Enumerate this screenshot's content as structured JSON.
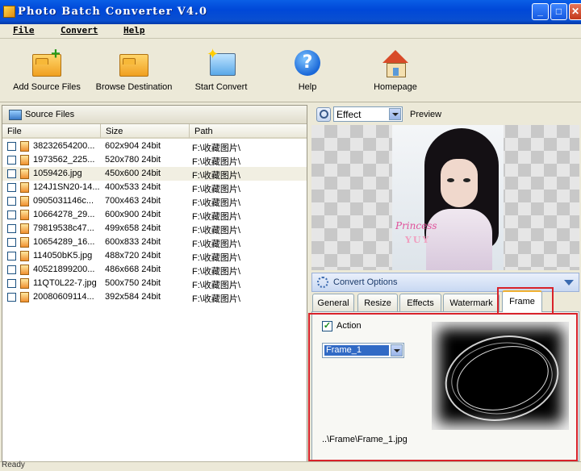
{
  "window": {
    "title": "Photo Batch Converter V4.0"
  },
  "menu": {
    "items": [
      "File",
      "Convert",
      "Help"
    ]
  },
  "toolbar": {
    "buttons": [
      {
        "label": "Add Source Files",
        "icon": "add-folder-icon"
      },
      {
        "label": "Browse Destination",
        "icon": "folder-icon"
      },
      {
        "label": "Start Convert",
        "icon": "magic-wand-icon"
      },
      {
        "label": "Help",
        "icon": "help-icon"
      },
      {
        "label": "Homepage",
        "icon": "home-icon"
      }
    ]
  },
  "source_files": {
    "title": "Source Files",
    "columns": [
      "File",
      "Size",
      "Path"
    ],
    "rows": [
      {
        "file": "38232654200...",
        "size": "602x904  24bit",
        "path": "F:\\收藏图片\\"
      },
      {
        "file": "1973562_225...",
        "size": "520x780  24bit",
        "path": "F:\\收藏图片\\"
      },
      {
        "file": "1059426.jpg",
        "size": "450x600  24bit",
        "path": "F:\\收藏图片\\"
      },
      {
        "file": "124J1SN20-14...",
        "size": "400x533  24bit",
        "path": "F:\\收藏图片\\"
      },
      {
        "file": "0905031146c...",
        "size": "700x463  24bit",
        "path": "F:\\收藏图片\\"
      },
      {
        "file": "10664278_29...",
        "size": "600x900  24bit",
        "path": "F:\\收藏图片\\"
      },
      {
        "file": "79819538c47...",
        "size": "499x658  24bit",
        "path": "F:\\收藏图片\\"
      },
      {
        "file": "10654289_16...",
        "size": "600x833  24bit",
        "path": "F:\\收藏图片\\"
      },
      {
        "file": "114050bK5.jpg",
        "size": "488x720  24bit",
        "path": "F:\\收藏图片\\"
      },
      {
        "file": "40521899200...",
        "size": "486x668  24bit",
        "path": "F:\\收藏图片\\"
      },
      {
        "file": "11QT0L22-7.jpg",
        "size": "500x750  24bit",
        "path": "F:\\收藏图片\\"
      },
      {
        "file": "20080609114...",
        "size": "392x584  24bit",
        "path": "F:\\收藏图片\\"
      }
    ],
    "selected_row": 2
  },
  "preview": {
    "effect_value": "Effect",
    "label": "Preview",
    "watermark_line1": "Princess",
    "watermark_line2": "YUY"
  },
  "convert_options": {
    "title": "Convert Options",
    "tabs": [
      "General",
      "Resize",
      "Effects",
      "Watermark",
      "Frame"
    ],
    "active_tab": "Frame",
    "frame": {
      "action_label": "Action",
      "action_checked": true,
      "frame_value": "Frame_1",
      "frame_path": "..\\Frame\\Frame_1.jpg"
    }
  },
  "status": {
    "text": "Ready"
  },
  "colors": {
    "titlebar": "#0048d8",
    "highlight": "#d8222a",
    "selection": "#316ac5"
  }
}
